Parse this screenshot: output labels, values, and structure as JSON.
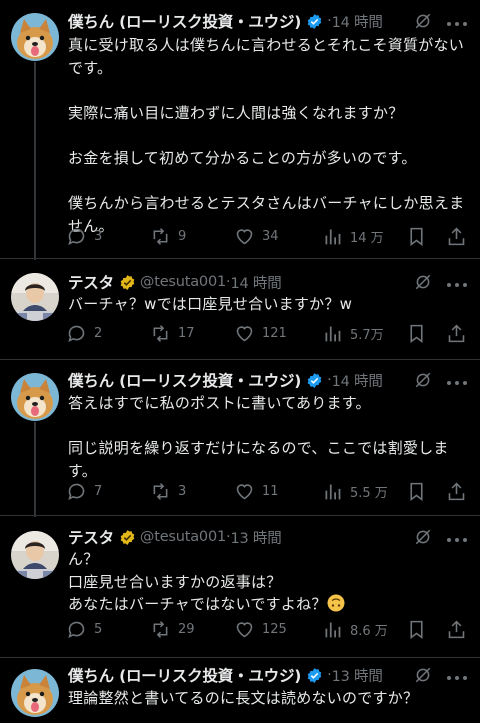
{
  "colors": {
    "background": "#000000",
    "text": "#e7e9ea",
    "secondary": "#71767b",
    "verified": "#1d9bf0",
    "gold_badge": "#e2b719",
    "divider": "#2f3336"
  },
  "tweets": [
    {
      "author": "僕ちん (ローリスク投資・ユウジ)",
      "handle": "",
      "time": "14 時間",
      "badge": "verified-blue",
      "lines": [
        "真に受け取る人は僕ちんに言わせるとそれこそ資質がない",
        "です。",
        "",
        "実際に痛い目に遭わずに人間は強くなれますか？",
        "",
        "お金を損して初めて分かることの方が多いのです。",
        "",
        "僕ちんから言わせるとテスタさんはバーチャにしか思えま",
        "せん。"
      ],
      "stats": {
        "replies": "3",
        "retweets": "9",
        "likes": "34",
        "views": "14 万"
      }
    },
    {
      "author": "テスタ",
      "handle": "@tesuta001",
      "time": "14 時間",
      "badge": "verified-gold",
      "lines": [
        "バーチャ？wでは口座見せ合いますか？w"
      ],
      "stats": {
        "replies": "2",
        "retweets": "17",
        "likes": "121",
        "views": "5.7万"
      }
    },
    {
      "author": "僕ちん (ローリスク投資・ユウジ)",
      "handle": "",
      "time": "14 時間",
      "badge": "verified-blue",
      "lines": [
        "答えはすでに私のポストに書いてあります。",
        "",
        "同じ説明を繰り返すだけになるので、ここでは割愛しま",
        "す。"
      ],
      "stats": {
        "replies": "7",
        "retweets": "3",
        "likes": "11",
        "views": "5.5 万"
      }
    },
    {
      "author": "テスタ",
      "handle": "@tesuta001",
      "time": "13 時間",
      "badge": "verified-gold",
      "lines": [
        "ん？",
        "口座見せ合いますかの返事は？",
        "あなたはバーチャではないですよね？"
      ],
      "emoji": "upside-down-face",
      "stats": {
        "replies": "5",
        "retweets": "29",
        "likes": "125",
        "views": "8.6 万"
      }
    },
    {
      "author": "僕ちん (ローリスク投資・ユウジ)",
      "handle": "",
      "time": "13 時間",
      "badge": "verified-blue",
      "lines": [
        "理論整然と書いてるのに長文は読めないのですか？"
      ]
    }
  ]
}
